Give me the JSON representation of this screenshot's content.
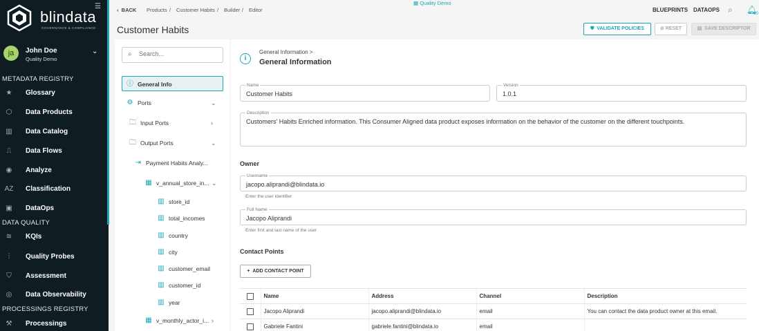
{
  "brand": {
    "name": "blindata",
    "tagline": "GOVERNANCE & COMPLIANCE"
  },
  "user": {
    "initials": "ja",
    "name": "John Doe",
    "org": "Quality Demo"
  },
  "sidebar": {
    "sections": [
      {
        "label": "METADATA REGISTRY"
      },
      {
        "label": "DATA QUALITY"
      },
      {
        "label": "PROCESSINGS REGISTRY"
      }
    ],
    "items": [
      {
        "label": "Glossary",
        "icon": "star-icon"
      },
      {
        "label": "Data Products",
        "icon": "hexagon-icon"
      },
      {
        "label": "Data Catalog",
        "icon": "catalog-icon"
      },
      {
        "label": "Data Flows",
        "icon": "flow-icon"
      },
      {
        "label": "Analyze",
        "icon": "compass-icon"
      },
      {
        "label": "Classification",
        "icon": "az-icon"
      },
      {
        "label": "DataOps",
        "icon": "dataops-icon"
      },
      {
        "label": "KQIs",
        "icon": "signal-icon"
      },
      {
        "label": "Quality Probes",
        "icon": "probe-icon"
      },
      {
        "label": "Assessment",
        "icon": "shield-icon"
      },
      {
        "label": "Data Observability",
        "icon": "observability-icon"
      },
      {
        "label": "Processings",
        "icon": "hammer-icon"
      }
    ]
  },
  "topbar": {
    "back": "BACK",
    "breadcrumbs": [
      "Products",
      "Customer Habits",
      "Builder",
      "Editor"
    ],
    "tenant": "Quality Demo",
    "nav": [
      "BLUEPRINTS",
      "DATAOPS"
    ],
    "notification_count": "10"
  },
  "page": {
    "title": "Customer Habits",
    "actions": {
      "validate": "VALIDATE POLICIES",
      "reset": "RESET",
      "save": "SAVE DESCRIPTOR"
    }
  },
  "tree": {
    "search_placeholder": "Search...",
    "items": [
      {
        "label": "General Info"
      },
      {
        "label": "Ports"
      },
      {
        "label": "Input Ports"
      },
      {
        "label": "Output Ports"
      },
      {
        "label": "Payment Habits Analy..."
      },
      {
        "label": "v_annual_store_in..."
      },
      {
        "label": "store_id"
      },
      {
        "label": "total_incomes"
      },
      {
        "label": "country"
      },
      {
        "label": "city"
      },
      {
        "label": "customer_email"
      },
      {
        "label": "customer_id"
      },
      {
        "label": "year"
      },
      {
        "label": "v_monthly_actor_i..."
      }
    ]
  },
  "main": {
    "breadcrumb": "General Information >",
    "title": "General Information",
    "name_label": "Name",
    "name_value": "Customer Habits",
    "version_label": "Version",
    "version_value": "1.0.1",
    "description_label": "Description",
    "description_value": "Customers' Habits Enriched information. This Consumer Aligned data product exposes information on the behavior of the customer on the different touchpoints.",
    "owner_heading": "Owner",
    "username_label": "Username",
    "username_value": "jacopo.aliprandi@blindata.io",
    "username_help": "Enter the user identifier",
    "fullname_label": "Full Name",
    "fullname_value": "Jacopo Aliprandi",
    "fullname_help": "Enter first and last name of the user",
    "contact_heading": "Contact Points",
    "add_contact": "ADD CONTACT POINT",
    "table": {
      "headers": [
        "Name",
        "Address",
        "Channel",
        "Description"
      ],
      "rows": [
        {
          "name": "Jacopo Aliprandi",
          "address": "jacopo.aliprandi@blindata.io",
          "channel": "email",
          "description": "You can contact the data product owner at this email."
        },
        {
          "name": "Gabriele Fantini",
          "address": "gabriele.fantini@blindata.io",
          "channel": "email",
          "description": ""
        }
      ]
    }
  },
  "colors": {
    "accent": "#1aa5b8",
    "sidebar_bg": "#0f1d22",
    "avatar_bg": "#a7d36a"
  }
}
